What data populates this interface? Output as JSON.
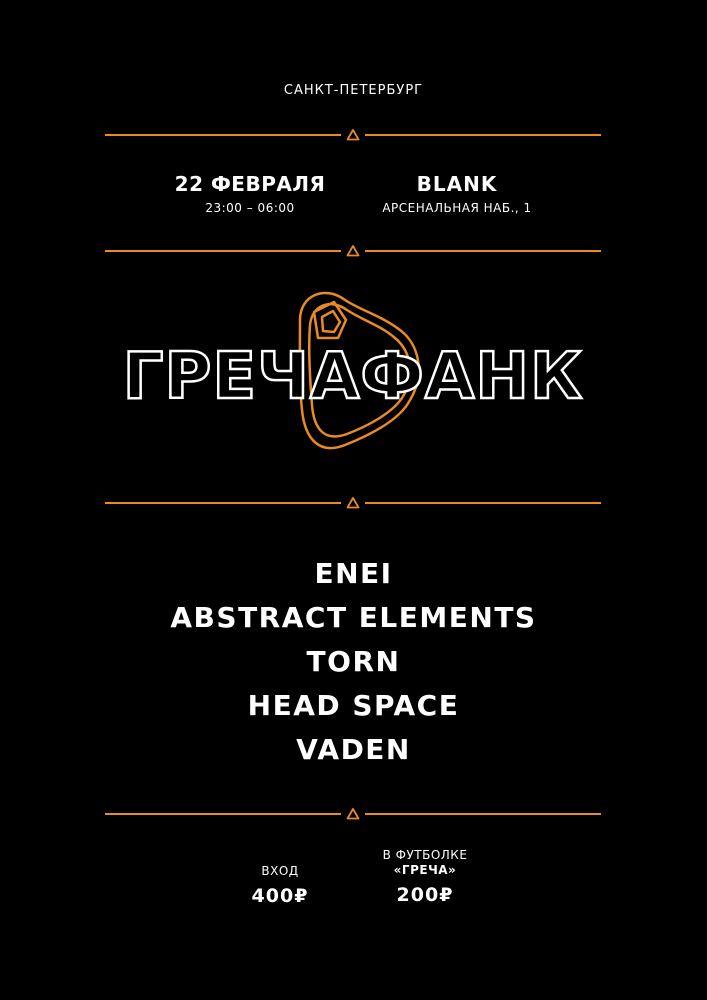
{
  "city": "САНКТ-ПЕТЕРБУРГ",
  "event": {
    "date": "22 ФЕВРАЛЯ",
    "time": "23:00 – 06:00",
    "venue": "BLANK",
    "address": "АРСЕНАЛЬНАЯ НАБ., 1"
  },
  "logo": {
    "text": "ГРЕЧАФАНК"
  },
  "lineup": [
    "ENEI",
    "ABSTRACT ELEMENTS",
    "TORN",
    "HEAD SPACE",
    "VADEN"
  ],
  "prices": {
    "entry_label": "ВХОД",
    "entry_price": "400₽",
    "shirt_label_line1": "В ФУТБОЛКЕ",
    "shirt_label_line2": "«ГРЕЧА»",
    "shirt_price": "200₽"
  },
  "colors": {
    "accent": "#e98b25",
    "background": "#000000",
    "text": "#ffffff"
  },
  "icons": {
    "divider": "grain-icon"
  }
}
